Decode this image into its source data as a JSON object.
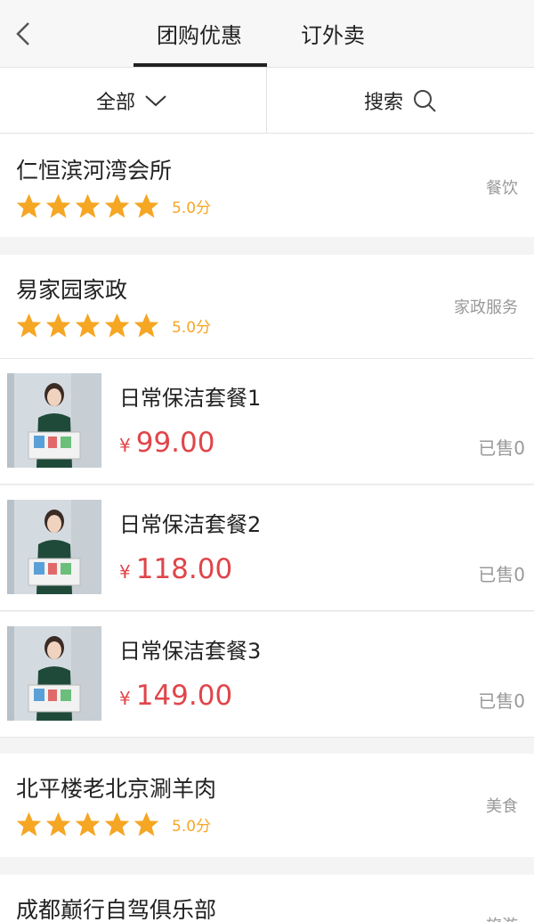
{
  "tabs": [
    "团购优惠",
    "订外卖"
  ],
  "filter": {
    "all_label": "全部",
    "search_label": "搜索"
  },
  "colors": {
    "star": "#f5a623",
    "price": "#e0454a"
  },
  "shops": [
    {
      "name": "仁恒滨河湾会所",
      "category": "餐饮",
      "score": "5.0分",
      "stars": 5
    },
    {
      "name": "易家园家政",
      "category": "家政服务",
      "score": "5.0分",
      "stars": 5
    },
    {
      "name": "北平楼老北京涮羊肉",
      "category": "美食",
      "score": "5.0分",
      "stars": 5
    },
    {
      "name": "成都巅行自驾俱乐部",
      "category": "旅游"
    }
  ],
  "deals": [
    {
      "name": "日常保洁套餐1",
      "currency": "¥",
      "price": "99.00",
      "sold": "已售0"
    },
    {
      "name": "日常保洁套餐2",
      "currency": "¥",
      "price": "118.00",
      "sold": "已售0"
    },
    {
      "name": "日常保洁套餐3",
      "currency": "¥",
      "price": "149.00",
      "sold": "已售0"
    }
  ]
}
